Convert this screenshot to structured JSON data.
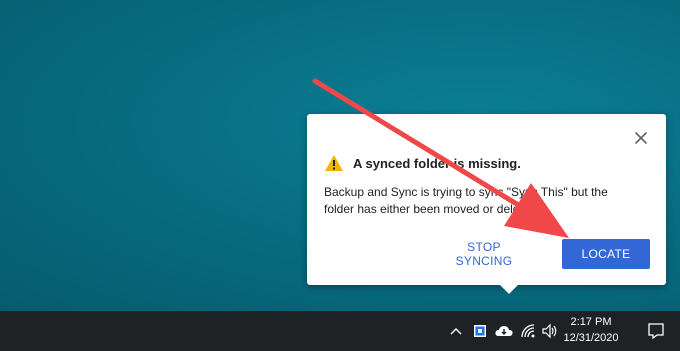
{
  "notification": {
    "title": "A synced folder is missing.",
    "body": "Backup and Sync is trying to sync \"Sync This\" but the folder has either been moved or deleted.",
    "stop_label": "STOP SYNCING",
    "locate_label": "LOCATE",
    "accent": "#3367d6",
    "warning_color": "#f4b400",
    "icons": {
      "close": "close-icon",
      "warning": "warning-icon"
    }
  },
  "annotation": {
    "color": "#f04848",
    "shape": "arrow"
  },
  "taskbar": {
    "time": "2:17 PM",
    "date": "12/31/2020",
    "tray_icons": [
      "chevron-up-icon",
      "backup-sync-icon",
      "cloud-icon",
      "wifi-icon",
      "volume-icon",
      "notification-icon"
    ]
  }
}
